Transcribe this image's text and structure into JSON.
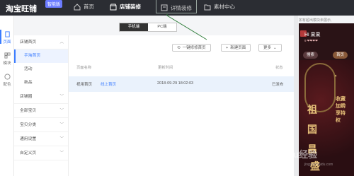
{
  "app": {
    "logo": "淘宝旺铺",
    "badge": "智能版"
  },
  "nav": {
    "home": "首页",
    "decoration": "店铺装修",
    "detail": "详情装修",
    "material": "素材中心"
  },
  "rail": [
    {
      "label": "页面",
      "icon": "page-icon",
      "active": true
    },
    {
      "label": "模块",
      "icon": "module-icon",
      "active": false
    },
    {
      "label": "配色",
      "icon": "palette-icon",
      "active": false
    }
  ],
  "menu": {
    "sections": [
      {
        "label": "店铺首页",
        "expanded": true,
        "children": [
          "手淘首页",
          "活动",
          "新品"
        ],
        "active_child": "手淘首页"
      },
      {
        "label": "店铺圈"
      },
      {
        "label": "全部宝贝"
      },
      {
        "label": "宝贝分类"
      },
      {
        "label": "通用设置"
      },
      {
        "label": "自定义页"
      }
    ]
  },
  "device": {
    "mobile": "手机端",
    "pc": "PC端",
    "selected": "手机端"
  },
  "toolbar": {
    "repair": "一键修修首页",
    "new_page": "新建页面",
    "more": "更多"
  },
  "table": {
    "headers": {
      "name": "页面名称",
      "time": "更新时间",
      "status": "状态"
    },
    "rows": [
      {
        "name": "视用首页",
        "badge": "线上首页",
        "time": "2018-09-29 18:02:03",
        "status": "已发布"
      }
    ]
  },
  "preview": {
    "tip": "如有超出模块未展示,",
    "shop_name": "Hi 果果",
    "sub": "9 ❤❤❤❤",
    "search_btn": "搜索",
    "home_btn": "首页",
    "art_big": [
      "祖",
      "国",
      "昌",
      "盛"
    ],
    "art_vert": "收藏加购享特权"
  },
  "watermark": {
    "brand": "Baidu经验",
    "sub": "jingyan.baidu.com"
  },
  "colors": {
    "accent": "#3b7cff",
    "topbar": "#2b2d33",
    "selected_row": "#eaf2fc"
  }
}
